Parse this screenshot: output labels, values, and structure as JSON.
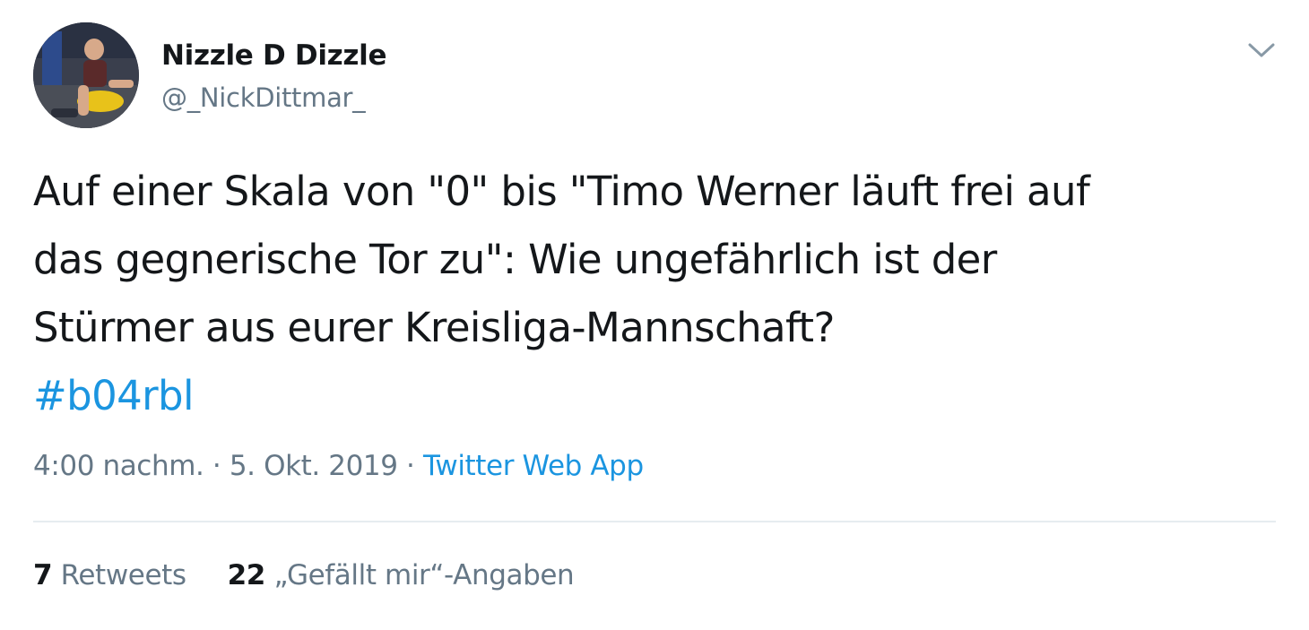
{
  "author": {
    "display_name": "Nizzle D Dizzle",
    "handle": "@_NickDittmar_"
  },
  "tweet": {
    "text_lines": [
      "Auf einer Skala von \"0\" bis \"Timo Werner läuft frei auf",
      "das gegnerische Tor zu\": Wie ungefährlich ist der",
      "Stürmer aus eurer Kreisliga-Mannschaft?"
    ],
    "hashtag": "#b04rbl"
  },
  "meta": {
    "time": "4:00 nachm.",
    "separator1": " · ",
    "date": "5. Okt. 2019",
    "separator2": " · ",
    "source": "Twitter Web App"
  },
  "stats": {
    "retweets_count": "7",
    "retweets_label": "Retweets",
    "likes_count": "22",
    "likes_label": "„Gefällt mir“-Angaben"
  },
  "icons": {
    "menu": "chevron-down-icon"
  },
  "colors": {
    "link": "#1b95e0",
    "secondary_text": "#657786",
    "primary_text": "#14171a",
    "divider": "#e6ecf0"
  }
}
